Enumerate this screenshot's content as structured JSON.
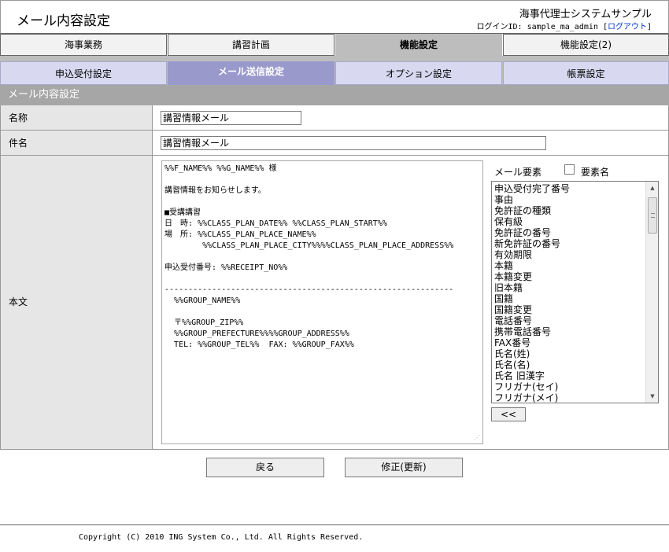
{
  "header": {
    "title": "メール内容設定",
    "system_name": "海事代理士システムサンプル",
    "login_label": "ログインID: sample_ma_admin",
    "logout_open": "[",
    "logout_label": "ログアウト",
    "logout_close": "]"
  },
  "main_tabs": [
    {
      "label": "海事業務"
    },
    {
      "label": "講習計画"
    },
    {
      "label": "機能設定"
    },
    {
      "label": "機能設定(2)"
    }
  ],
  "sub_tabs": [
    {
      "label": "申込受付設定"
    },
    {
      "label": "メール送信設定"
    },
    {
      "label": "オプション設定"
    },
    {
      "label": "帳票設定"
    }
  ],
  "section_title": "メール内容設定",
  "form": {
    "name_label": "名称",
    "name_value": "講習情報メール",
    "subject_label": "件名",
    "subject_value": "講習情報メール",
    "body_label": "本文",
    "body_value": "%%F_NAME%% %%G_NAME%% 様\n\n講習情報をお知らせします。\n\n■受講講習\n日　時: %%CLASS_PLAN_DATE%% %%CLASS_PLAN_START%%\n場　所: %%CLASS_PLAN_PLACE_NAME%%\n        %%CLASS_PLAN_PLACE_CITY%%%%CLASS_PLAN_PLACE_ADDRESS%%\n\n申込受付番号: %%RECEIPT_NO%%\n\n-------------------------------------------------------------\n  %%GROUP_NAME%%\n\n  〒%%GROUP_ZIP%%\n  %%GROUP_PREFECTURE%%%%GROUP_ADDRESS%%\n  TEL: %%GROUP_TEL%%  FAX: %%GROUP_FAX%%"
  },
  "elements": {
    "label": "メール要素",
    "checkbox_label": "要素名",
    "items": [
      "申込受付完了番号",
      "事由",
      "免許証の種類",
      "保有級",
      "免許証の番号",
      "新免許証の番号",
      "有効期限",
      "本籍",
      "本籍変更",
      "旧本籍",
      "国籍",
      "国籍変更",
      "電話番号",
      "携帯電話番号",
      "FAX番号",
      "氏名(姓)",
      "氏名(名)",
      "氏名 旧漢字",
      "フリガナ(セイ)",
      "フリガナ(メイ)"
    ],
    "insert_label": "<<"
  },
  "buttons": {
    "back": "戻る",
    "update": "修正(更新)"
  },
  "footer": {
    "copyright": "Copyright (C) 2010 ING System Co., Ltd. All Rights Reserved."
  }
}
